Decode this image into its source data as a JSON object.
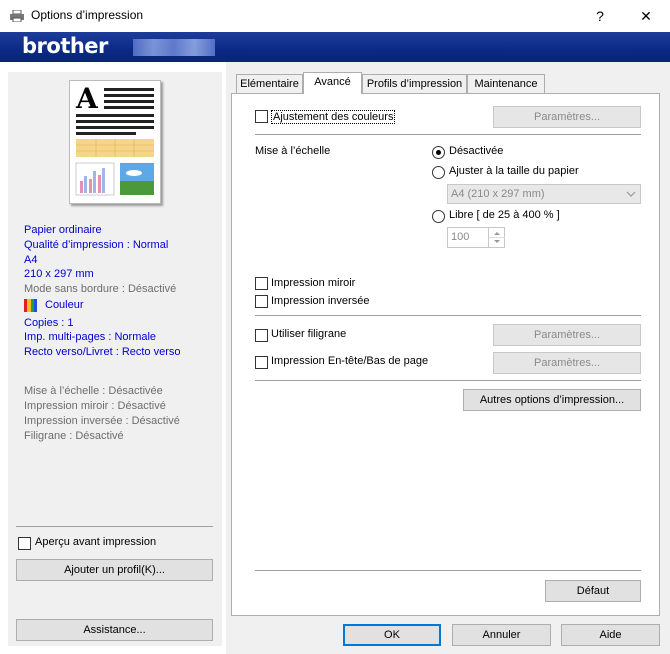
{
  "window": {
    "title": "Options d’impression",
    "help_glyph": "?",
    "close_glyph": "✕"
  },
  "brand": {
    "logo": "brother"
  },
  "tabs": [
    {
      "label": "Elémentaire"
    },
    {
      "label": "Avancé"
    },
    {
      "label": "Profils d’impression"
    },
    {
      "label": "Maintenance"
    }
  ],
  "advanced": {
    "color_adjust_label": "Ajustement des couleurs",
    "color_adjust_settings": "Paramètres...",
    "scaling_label": "Mise à l’échelle",
    "scaling_off": "Désactivée",
    "scaling_fit": "Ajuster à la taille du papier",
    "paper_select_value": "A4 (210 x 297 mm)",
    "scaling_free": "Libre  [ de 25 à 400 % ]",
    "scaling_value": "100",
    "mirror_label": "Impression miroir",
    "reverse_label": "Impression inversée",
    "watermark_label": "Utiliser filigrane",
    "watermark_settings": "Paramètres...",
    "header_footer_label": "Impression En-tête/Bas de page",
    "header_footer_settings": "Paramètres...",
    "other_options": "Autres options d’impression...",
    "default_button": "Défaut"
  },
  "summary": {
    "lines_blue": [
      "Papier ordinaire",
      "Qualité d’impression : Normal",
      "A4",
      "210 x 297 mm"
    ],
    "borderless": "Mode sans bordure : Désactivé",
    "color": "Couleur",
    "lines_blue2": [
      "Copies : 1",
      "Imp. multi-pages : Normale",
      "Recto verso/Livret : Recto verso"
    ],
    "lines_gray": [
      "Mise à l’échelle : Désactivée",
      "Impression miroir : Désactivé",
      "Impression inversée : Désactivé",
      "Filigrane : Désactivé"
    ]
  },
  "left": {
    "preview_label": "Aperçu avant impression",
    "add_profile": "Ajouter un profil(K)...",
    "assistance": "Assistance..."
  },
  "footer": {
    "ok": "OK",
    "cancel": "Annuler",
    "help": "Aide"
  }
}
